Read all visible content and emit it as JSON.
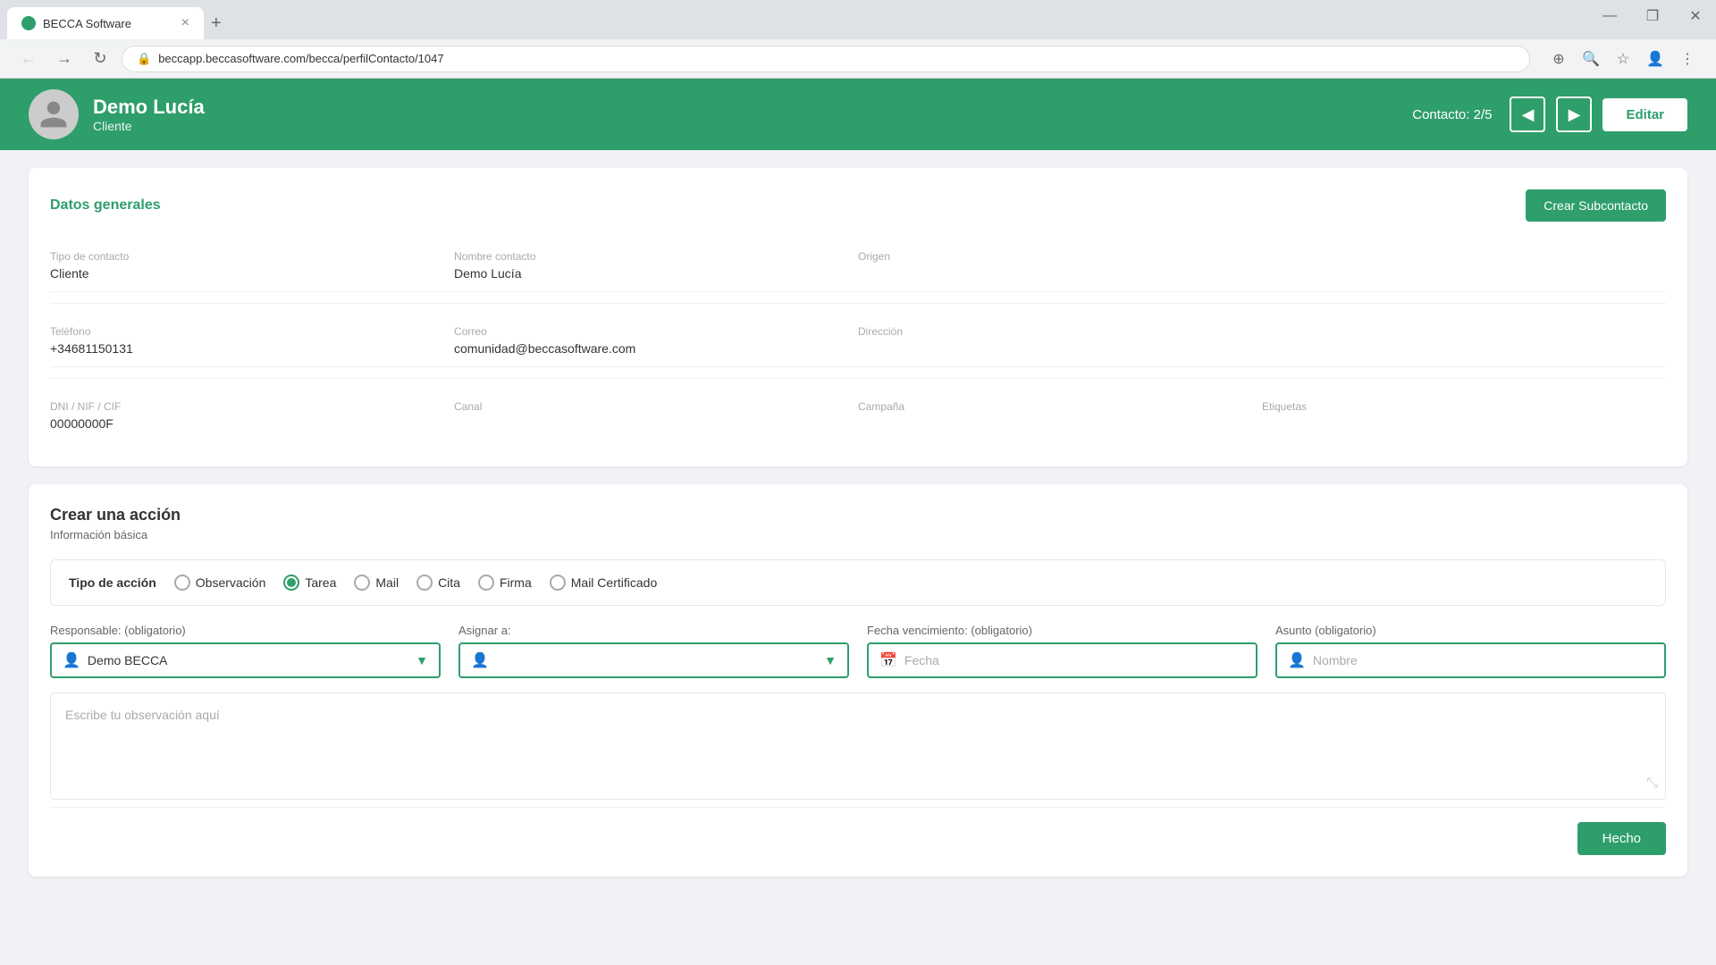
{
  "browser": {
    "tab_title": "BECCA Software",
    "tab_close": "×",
    "tab_new": "+",
    "url": "beccapp.beccasoftware.com/becca/perfilContacto/1047",
    "nav_back": "←",
    "nav_forward": "→",
    "nav_refresh": "↻",
    "window_minimize": "—",
    "window_maximize": "❐",
    "window_close": "✕"
  },
  "header": {
    "contact_name": "Demo Lucía",
    "contact_role": "Cliente",
    "counter_label": "Contacto:",
    "counter_value": "2/5",
    "nav_prev": "◀",
    "nav_next": "▶",
    "edit_label": "Editar"
  },
  "datos_generales": {
    "title": "Datos generales",
    "create_subcontact_label": "Crear Subcontacto",
    "fields": [
      {
        "label": "Tipo de contacto",
        "value": "Cliente"
      },
      {
        "label": "Nombre contacto",
        "value": "Demo Lucía"
      },
      {
        "label": "Origen",
        "value": ""
      },
      {
        "label": "",
        "value": ""
      },
      {
        "label": "Teléfono",
        "value": "+34681150131"
      },
      {
        "label": "Correo",
        "value": "comunidad@beccasoftware.com"
      },
      {
        "label": "Dirección",
        "value": ""
      },
      {
        "label": "",
        "value": ""
      },
      {
        "label": "DNI / NIF / CIF",
        "value": "00000000F"
      },
      {
        "label": "Canal",
        "value": ""
      },
      {
        "label": "Campaña",
        "value": ""
      },
      {
        "label": "Etiquetas",
        "value": ""
      }
    ]
  },
  "crear_accion": {
    "title": "Crear una acción",
    "subtitle": "Información básica",
    "tipo_label": "Tipo de acción",
    "options": [
      {
        "label": "Observación",
        "selected": false
      },
      {
        "label": "Tarea",
        "selected": true
      },
      {
        "label": "Mail",
        "selected": false
      },
      {
        "label": "Cita",
        "selected": false
      },
      {
        "label": "Firma",
        "selected": false
      },
      {
        "label": "Mail Certificado",
        "selected": false
      }
    ],
    "responsable_label": "Responsable: (obligatorio)",
    "responsable_value": "Demo BECCA",
    "asignar_label": "Asignar a:",
    "asignar_placeholder": "",
    "fecha_label": "Fecha vencimiento: (obligatorio)",
    "fecha_placeholder": "Fecha",
    "asunto_label": "Asunto (obligatorio)",
    "asunto_placeholder": "Nombre",
    "textarea_placeholder": "Escribe tu observación aquí",
    "done_label": "Hecho"
  }
}
